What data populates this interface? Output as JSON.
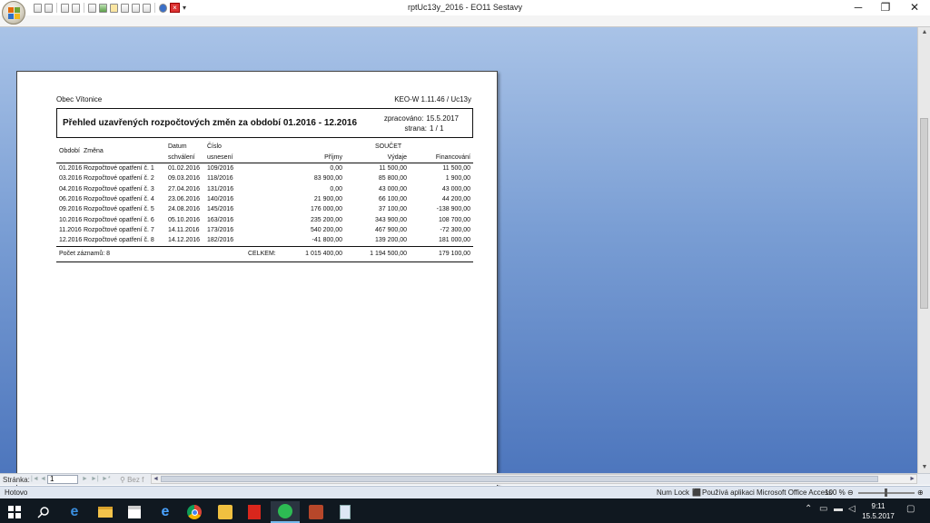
{
  "window": {
    "title": "rptUc13y_2016 - EO11 Sestavy",
    "minimize": "─",
    "maximize": "❐",
    "close": "✕"
  },
  "report": {
    "org": "Obec Vítonice",
    "version": "KEO-W 1.11.46 / Uc13y",
    "title": "Přehled uzavřených rozpočtových změn za období 01.2016 - 12.2016",
    "processed_label": "zpracováno:",
    "processed_value": "15.5.2017",
    "page_label": "strana:",
    "page_value": "1 / 1",
    "headers": {
      "obdobi": "Období",
      "zmena": "Změna",
      "datum": "Datum",
      "schvaleni": "schválení",
      "cislo": "Číslo",
      "usneseni": "usnesení",
      "soucet": "SOUČET",
      "prijmy": "Příjmy",
      "vydaje": "Výdaje",
      "financovani": "Financování"
    },
    "rows": [
      {
        "obdobi": "01.2016",
        "zmena": "Rozpočtové opatření č. 1",
        "datum": "01.02.2016",
        "cislo": "109/2016",
        "prijmy": "0,00",
        "vydaje": "11 500,00",
        "fin": "11 500,00"
      },
      {
        "obdobi": "03.2016",
        "zmena": "Rozpočtové opatření č. 2",
        "datum": "09.03.2016",
        "cislo": "118/2016",
        "prijmy": "83 900,00",
        "vydaje": "85 800,00",
        "fin": "1 900,00"
      },
      {
        "obdobi": "04.2016",
        "zmena": "Rozpočtové opatření č. 3",
        "datum": "27.04.2016",
        "cislo": "131/2016",
        "prijmy": "0,00",
        "vydaje": "43 000,00",
        "fin": "43 000,00"
      },
      {
        "obdobi": "06.2016",
        "zmena": "Rozpočtové opatření č. 4",
        "datum": "23.06.2016",
        "cislo": "140/2016",
        "prijmy": "21 900,00",
        "vydaje": "66 100,00",
        "fin": "44 200,00"
      },
      {
        "obdobi": "09.2016",
        "zmena": "Rozpočtové opatření č. 5",
        "datum": "24.08.2016",
        "cislo": "145/2016",
        "prijmy": "176 000,00",
        "vydaje": "37 100,00",
        "fin": "-138 900,00"
      },
      {
        "obdobi": "10.2016",
        "zmena": "Rozpočtové opatření č. 6",
        "datum": "05.10.2016",
        "cislo": "163/2016",
        "prijmy": "235 200,00",
        "vydaje": "343 900,00",
        "fin": "108 700,00"
      },
      {
        "obdobi": "11.2016",
        "zmena": "Rozpočtové opatření č. 7",
        "datum": "14.11.2016",
        "cislo": "173/2016",
        "prijmy": "540 200,00",
        "vydaje": "467 900,00",
        "fin": "-72 300,00"
      },
      {
        "obdobi": "12.2016",
        "zmena": "Rozpočtové opatření č. 8",
        "datum": "14.12.2016",
        "cislo": "182/2016",
        "prijmy": "-41 800,00",
        "vydaje": "139 200,00",
        "fin": "181 000,00"
      }
    ],
    "footer": {
      "count_label": "Počet záznamů: 8",
      "total_label": "CELKEM:",
      "prijmy": "1 015 400,00",
      "vydaje": "1 194 500,00",
      "fin": "179 100,00"
    }
  },
  "recnav": {
    "label": "Stránka:",
    "page": "1",
    "filter": "Bez f"
  },
  "status": {
    "left": "Hotovo",
    "numlock": "Num Lock",
    "access": "Používá aplikaci Microsoft Office Access",
    "zoom": "100 %"
  },
  "taskbar": {
    "time": "9:11",
    "date": "15.5.2017"
  }
}
